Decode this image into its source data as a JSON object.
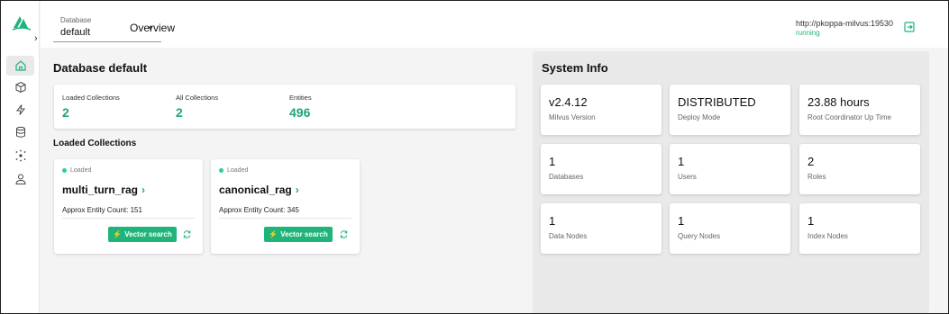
{
  "header": {
    "database_label": "Database",
    "database_value": "default",
    "page_title": "Overview",
    "server_address": "http://pkoppa-milvus:19530",
    "server_status": "running"
  },
  "sidebar": {
    "items": [
      "home",
      "collections",
      "search",
      "databases",
      "system",
      "users"
    ]
  },
  "main": {
    "title": "Database default",
    "stats": [
      {
        "label": "Loaded Collections",
        "value": "2"
      },
      {
        "label": "All Collections",
        "value": "2"
      },
      {
        "label": "Entities",
        "value": "496"
      }
    ],
    "loaded_title": "Loaded Collections",
    "collections": [
      {
        "status": "Loaded",
        "name": "multi_turn_rag",
        "count_label": "Approx Entity Count:",
        "count": "151",
        "button": "Vector search"
      },
      {
        "status": "Loaded",
        "name": "canonical_rag",
        "count_label": "Approx Entity Count:",
        "count": "345",
        "button": "Vector search"
      }
    ]
  },
  "system": {
    "title": "System Info",
    "cards": [
      {
        "value": "v2.4.12",
        "label": "Milvus Version"
      },
      {
        "value": "DISTRIBUTED",
        "label": "Deploy Mode"
      },
      {
        "value": "23.88 hours",
        "label": "Root Coordinator Up Time"
      },
      {
        "value": "1",
        "label": "Databases"
      },
      {
        "value": "1",
        "label": "Users"
      },
      {
        "value": "2",
        "label": "Roles"
      },
      {
        "value": "1",
        "label": "Data Nodes"
      },
      {
        "value": "1",
        "label": "Query Nodes"
      },
      {
        "value": "1",
        "label": "Index Nodes"
      }
    ]
  },
  "colors": {
    "accent": "#1fb57a",
    "stat_value": "#1ea672",
    "status_running": "#22b573"
  }
}
